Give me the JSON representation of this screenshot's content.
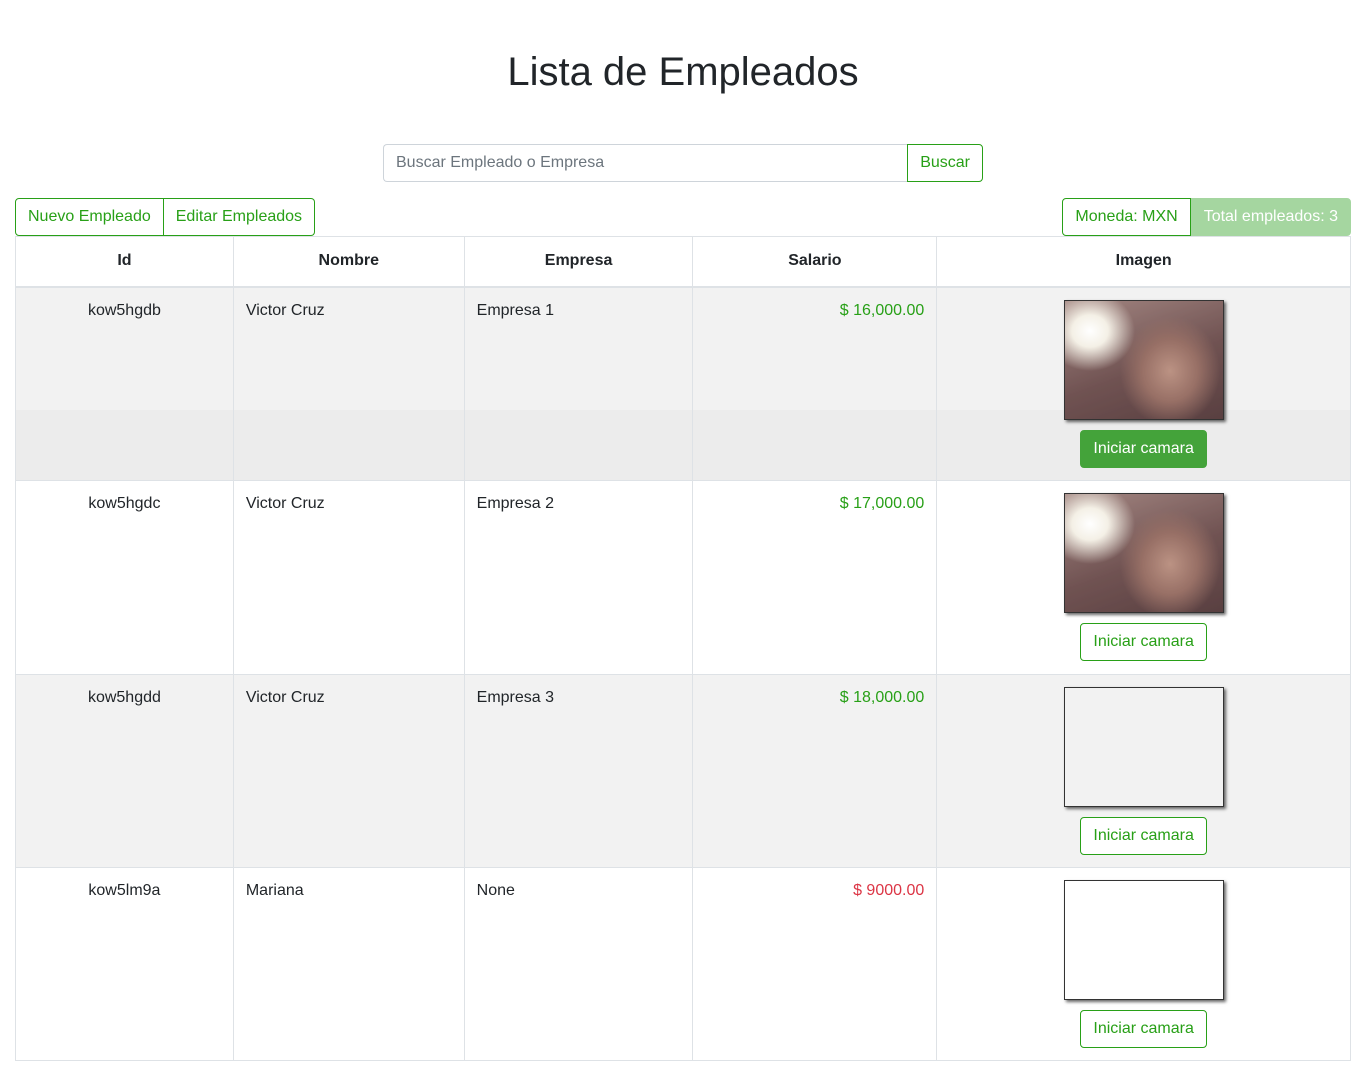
{
  "page": {
    "title": "Lista de Empleados"
  },
  "search": {
    "placeholder": "Buscar Empleado o Empresa",
    "value": "",
    "button_label": "Buscar"
  },
  "toolbar": {
    "new_label": "Nuevo Empleado",
    "edit_label": "Editar Empleados",
    "currency_label": "Moneda: MXN",
    "total_label": "Total empleados: 3"
  },
  "colors": {
    "accent": "#28a017",
    "salary_low": "#dc3545",
    "total_badge_bg": "#a5d6a0"
  },
  "table": {
    "headers": [
      "Id",
      "Nombre",
      "Empresa",
      "Salario",
      "Imagen"
    ],
    "rows": [
      {
        "id": "kow5hgdb",
        "name": "Victor Cruz",
        "company": "Empresa 1",
        "salary": "$ 16,000.00",
        "salary_status": "ok",
        "photo": "captured-photo",
        "camera_label": "Iniciar camara",
        "camera_active": true
      },
      {
        "id": "kow5hgdc",
        "name": "Victor Cruz",
        "company": "Empresa 2",
        "salary": "$ 17,000.00",
        "salary_status": "ok",
        "photo": "captured-photo",
        "camera_label": "Iniciar camara",
        "camera_active": false
      },
      {
        "id": "kow5hgdd",
        "name": "Victor Cruz",
        "company": "Empresa 3",
        "salary": "$ 18,000.00",
        "salary_status": "ok",
        "photo": "empty",
        "camera_label": "Iniciar camara",
        "camera_active": false
      },
      {
        "id": "kow5lm9a",
        "name": "Mariana",
        "company": "None",
        "salary": "$ 9000.00",
        "salary_status": "low",
        "photo": "empty",
        "camera_label": "Iniciar camara",
        "camera_active": false
      }
    ]
  }
}
